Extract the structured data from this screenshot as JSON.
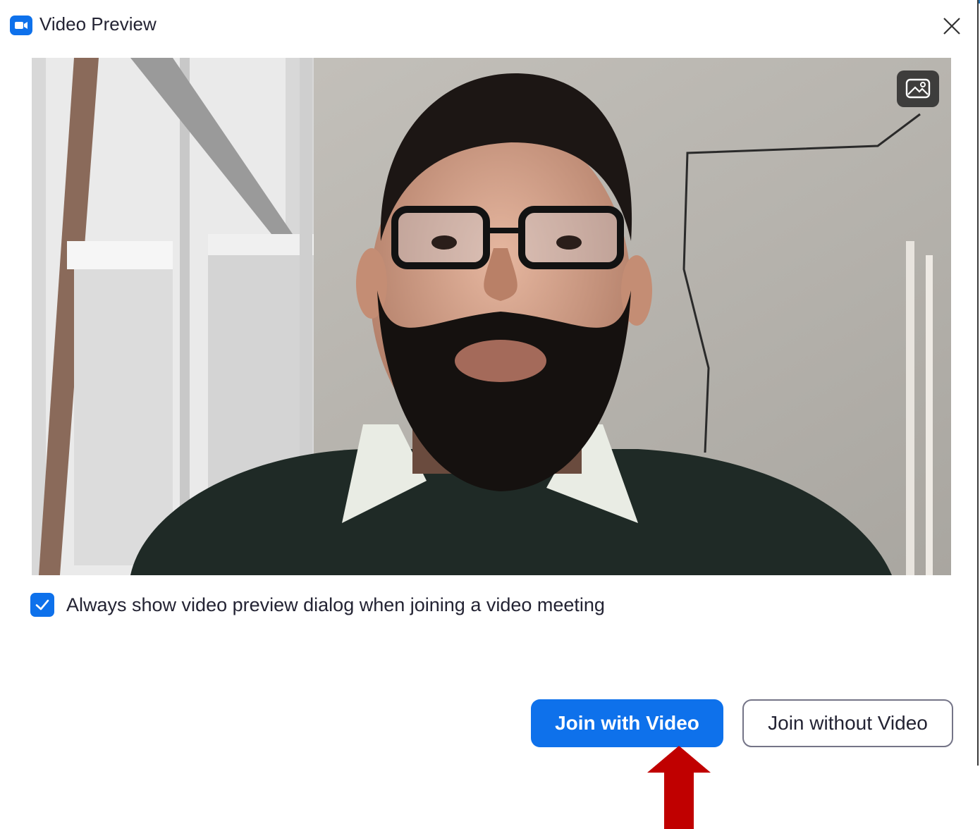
{
  "window": {
    "title": "Video Preview",
    "app_icon": "zoom-camera-icon",
    "close_icon": "close-icon"
  },
  "video_preview": {
    "background_button_icon": "virtual-background-icon"
  },
  "options": {
    "always_show_preview_label": "Always show video preview dialog when joining a video meeting",
    "always_show_preview_checked": true
  },
  "actions": {
    "join_with_video_label": "Join with Video",
    "join_without_video_label": "Join without Video"
  },
  "annotation": {
    "arrow_icon": "red-up-arrow-icon",
    "arrow_color": "#c00000"
  },
  "colors": {
    "accent": "#0e71eb",
    "text": "#232333"
  }
}
